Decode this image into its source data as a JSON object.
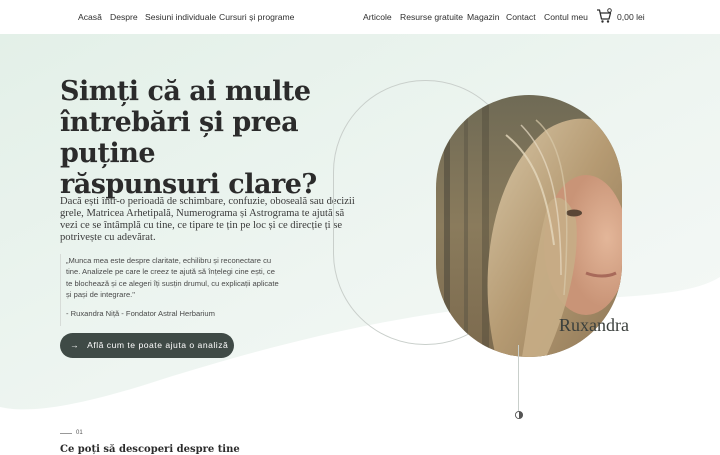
{
  "nav": {
    "left_items": [
      "Acasă",
      "Despre",
      "Sesiuni individuale",
      "Cursuri și programe"
    ],
    "right_items": [
      "Articole",
      "Resurse gratuite",
      "Magazin",
      "Contact",
      "Contul meu"
    ],
    "cart_total": "0,00 lei"
  },
  "hero": {
    "headline": "Simți că ai multe întrebări și prea puține răspunsuri clare?",
    "intro": "Dacă ești într-o perioadă de schimbare, confuzie, oboseală sau decizii grele, Matricea Arhetipală, Numerograma și Astrograma te ajută să vezi ce se întâmplă cu tine, ce tipare te țin pe loc și ce direcție ți se potrivește cu adevărat.",
    "quote": "„Munca mea este despre claritate, echilibru și reconectare cu tine. Analizele pe care le creez te ajută să înțelegi cine ești, ce te blochează și ce alegeri îți susțin drumul, cu explicații aplicate și pași de integrare.\"",
    "quote_author": "- Ruxandra Niță - Fondator Astral Herbarium",
    "cta_label": "Află cum te poate ajuta o analiză",
    "photo_caption": "Ruxandra"
  },
  "next_section": {
    "number": "01",
    "title": "Ce poți să descoperi despre tine"
  },
  "colors": {
    "hero_bg": "#eaf3ee",
    "cta_bg": "#3f4a46",
    "text": "#2b2b2b"
  },
  "icons": [
    "cart-icon",
    "arrow-right-icon",
    "moon-icon"
  ]
}
